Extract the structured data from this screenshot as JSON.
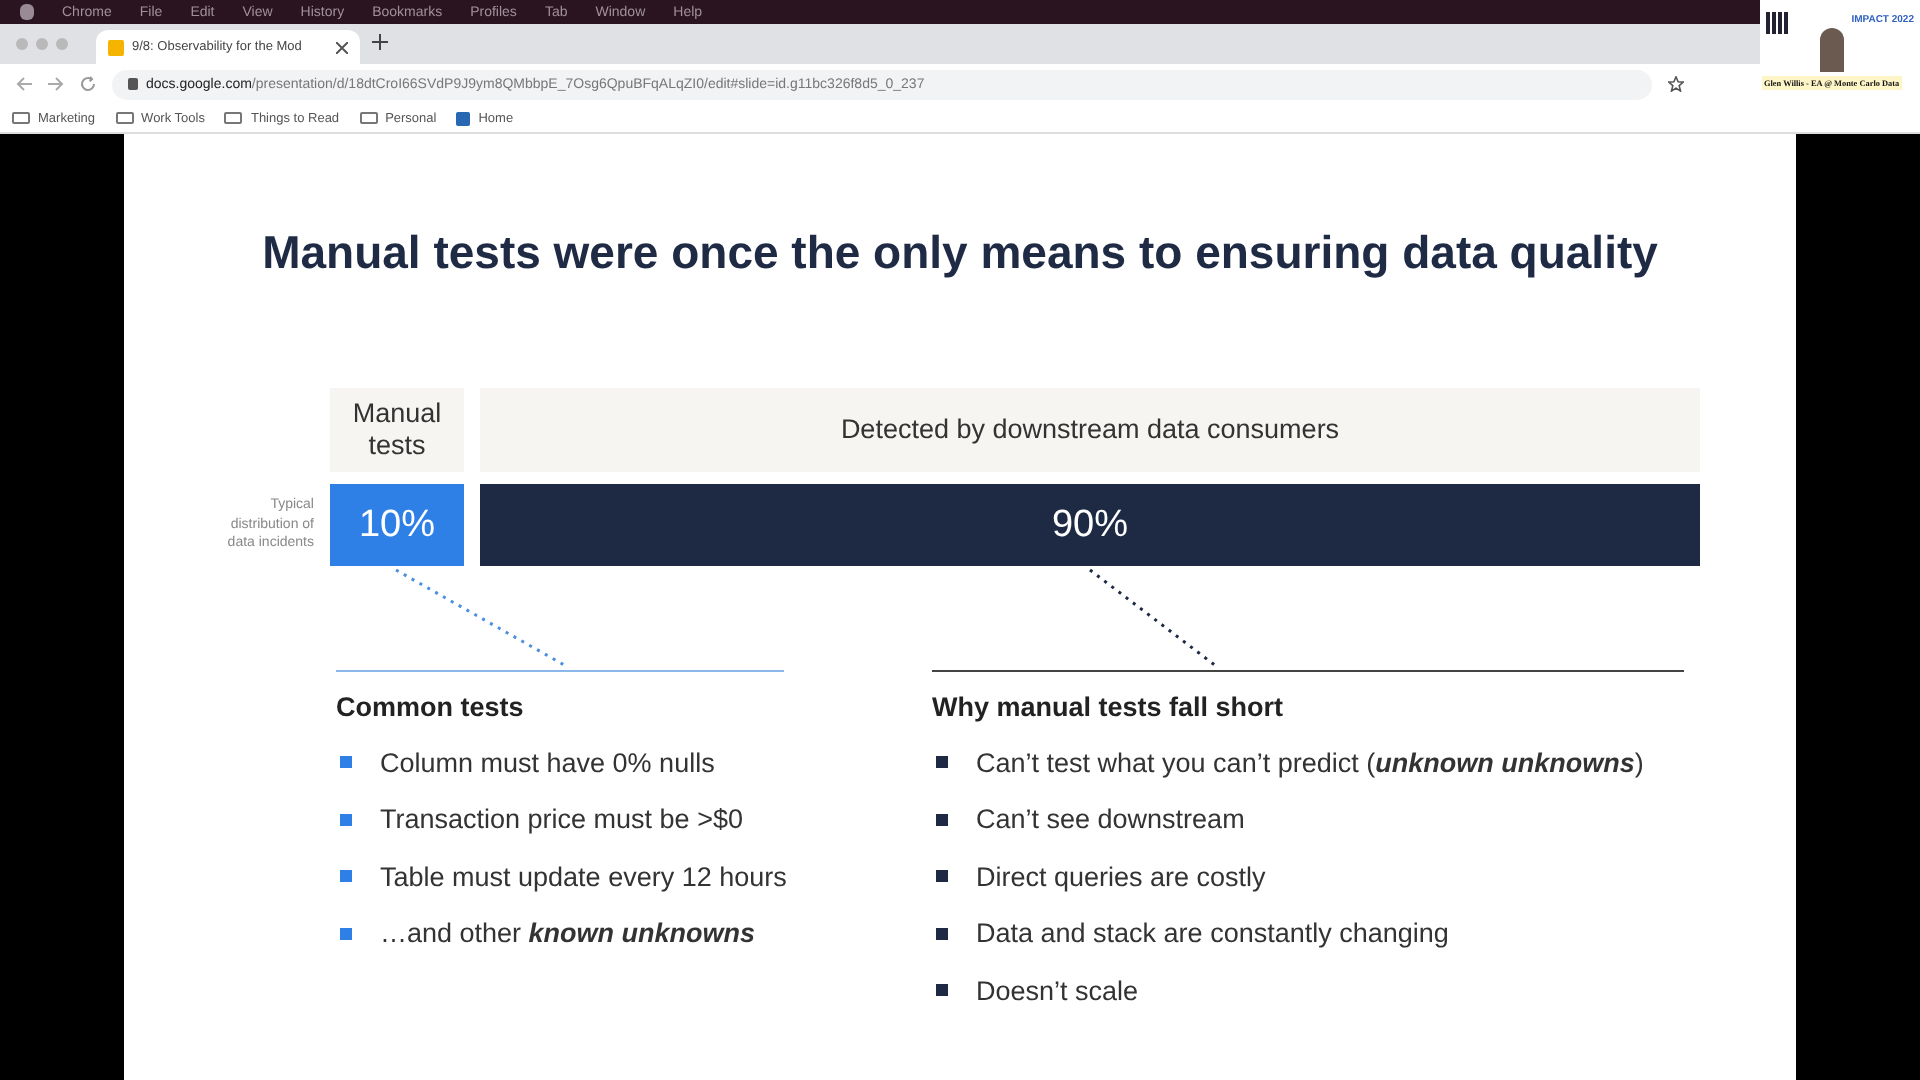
{
  "menu_bar": {
    "items": [
      "Chrome",
      "File",
      "Edit",
      "View",
      "History",
      "Bookmarks",
      "Profiles",
      "Tab",
      "Window",
      "Help"
    ]
  },
  "tabs": [
    {
      "title": "9/8: Observability for the Mod",
      "selected": true
    }
  ],
  "address_bar": {
    "url_host": "docs.google.com",
    "url_path": "/presentation/d/18dtCroI66SVdP9J9ym8QMbbpE_7Osg6QpuBFqALqZI0/edit#slide=id.g11bc326f8d5_0_237"
  },
  "bookmarks": [
    {
      "label": "Marketing",
      "kind": "folder"
    },
    {
      "label": "Work Tools",
      "kind": "folder"
    },
    {
      "label": "Things to Read",
      "kind": "folder"
    },
    {
      "label": "Personal",
      "kind": "folder"
    },
    {
      "label": "Home",
      "kind": "site"
    }
  ],
  "webcam": {
    "event": "IMPACT 2022",
    "caption": "Glen Willis - EA @ Monte Carlo Data"
  },
  "slide": {
    "title": "Manual tests were once the only means to ensuring data quality",
    "row_label": "Typical distribution of data incidents",
    "segments": [
      {
        "kind": "manual",
        "header": "Manual tests",
        "value": "10%"
      },
      {
        "kind": "downstream",
        "header": "Detected by downstream data consumers",
        "value": "90%"
      }
    ],
    "columns": [
      {
        "kind": "manual",
        "heading": "Common tests",
        "items": [
          "Column must have 0% nulls",
          "Transaction price must be >$0",
          "Table must update every 12 hours",
          "…and other **known unknowns**"
        ]
      },
      {
        "kind": "downstream",
        "heading": "Why manual tests fall short",
        "items": [
          "Can’t test what you can’t predict (**unknown unknowns**)",
          "Can’t see downstream",
          "Direct queries are costly",
          "Data and stack are constantly changing",
          "Doesn’t scale"
        ]
      }
    ]
  }
}
